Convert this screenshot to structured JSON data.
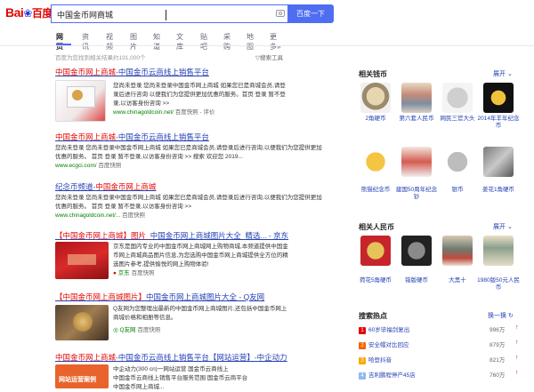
{
  "search": {
    "logo_text_1": "Bai",
    "logo_paw": "❀",
    "logo_text_2": "百度",
    "query": "中国金币网商城",
    "button_label": "百度一下"
  },
  "tabs": [
    "网页",
    "资讯",
    "视频",
    "图片",
    "知道",
    "文库",
    "贴吧",
    "采购",
    "地图",
    "更多»"
  ],
  "meta": {
    "result_count": "百度为您找到相关结果约191,000个",
    "search_tools": "搜索工具"
  },
  "results": [
    {
      "title_pre": "中国金币网上商城",
      "title_post": "-中国金币云商线上销售平台",
      "lines": [
        "您尚未登录 您尚未登录中国金币网上商城 如果您已是商城会员,请登",
        "录后进行咨询 以便我们为您提供更加优惠的服务。首页 登录 暂不登",
        "录,以访客身份咨询 >>"
      ],
      "url": "www.chinagoldcoin.net/",
      "snap": "百度快照 - 评价"
    },
    {
      "title_pre": "中国金币网上商城",
      "title_post": "-中国金币云商线上销售平台",
      "lines": [
        "您尚未登录 您尚未登录中国金币网上商城 如果您已是商城会员,请登录后进行咨询,以便我们为您提供更加",
        "优惠的服务。 首页 登录 暂不登录,以访客身份咨询 >> 搜索 欢迎您 2019..."
      ],
      "url": "www.ecgci.com/",
      "snap": "百度快照"
    },
    {
      "title_pre": "纪念币频道-",
      "title_post": "中国金币网上商城",
      "lines": [
        "您尚未登录 您尚未登录中国金币网上商城 如果您已是商城会员,请登录后进行咨询,以便我们为您提供更加",
        "优惠的服务。 首页 登录 暂不登录,以访客身份咨询 >>"
      ],
      "url": "www.chinagoldcoin.net/...",
      "snap": "百度快照"
    },
    {
      "title_pre": "【中国金币网上商城】图片_",
      "title_post": "中国金币网上商城图片大全_精选... - 京东",
      "lines": [
        "京东是国内专业的中国金币网上商城网上购物商城,本频道提供中国金",
        "币网上商城商品图片信息,为您选购中国金币网上商城提供全方位的精",
        "选图片参考,提供愉悦的网上购物体验!"
      ],
      "url": "京东",
      "snap": "百度快照"
    },
    {
      "title_pre": "【中国金币网上商城图片】",
      "title_post": "中国金币网上商城图片大全 - Q友网",
      "lines": [
        "Q友网为您整理出最新的中国金币网上商城图片,还包括中国金币网上",
        "商城价格和相册等信息。"
      ],
      "url": "Q友网",
      "snap": "百度快照"
    },
    {
      "title_pre": "中国金币网上商城",
      "title_post": "-中国金币云商线上销售平台【网站运营】-中企动力",
      "lines": [
        "中企动力(300 cn)一网站运营 国金币云商线上",
        "中国金币云商线上销售平台服务范围 国金币云商平台",
        "中国金币网上商城..."
      ],
      "url": "",
      "snap": ""
    }
  ],
  "thumb_text": {
    "result1_thumb": "",
    "result4_thumb": "",
    "result6_thumb": "网站运营案例"
  },
  "related_coins": {
    "header": "相关钱币",
    "expand": "展开",
    "items": [
      {
        "label": "2角硬币"
      },
      {
        "label": "第六套人民币"
      },
      {
        "label": "网民三官大头"
      },
      {
        "label": "2014年羊年纪念币"
      },
      {
        "label": "熊猫纪念币"
      },
      {
        "label": "建国50周年纪念钞"
      },
      {
        "label": "银币"
      },
      {
        "label": "姜花1角硬币"
      }
    ]
  },
  "related_rmb": {
    "header": "相关人民币",
    "expand": "展开",
    "items": [
      {
        "label": "荷花5角硬币"
      },
      {
        "label": "错版硬币"
      },
      {
        "label": "大黑十"
      },
      {
        "label": "1980版50元人民币"
      }
    ]
  },
  "hot": {
    "header": "搜索热点",
    "refresh": "换一换",
    "items": [
      {
        "rank": "1",
        "text": "60岁毕福剑复出",
        "count": "996万"
      },
      {
        "rank": "2",
        "text": "安全帽对比回应",
        "count": "879万"
      },
      {
        "rank": "3",
        "text": "哈登抖音",
        "count": "821万"
      },
      {
        "rank": "4",
        "text": "吉利鹏程停产45店",
        "count": "760万"
      }
    ]
  },
  "colors": {
    "brand_red": "#e10602",
    "link_blue": "#2440b3",
    "button_blue": "#4e6ef2",
    "url_green": "#008000"
  }
}
